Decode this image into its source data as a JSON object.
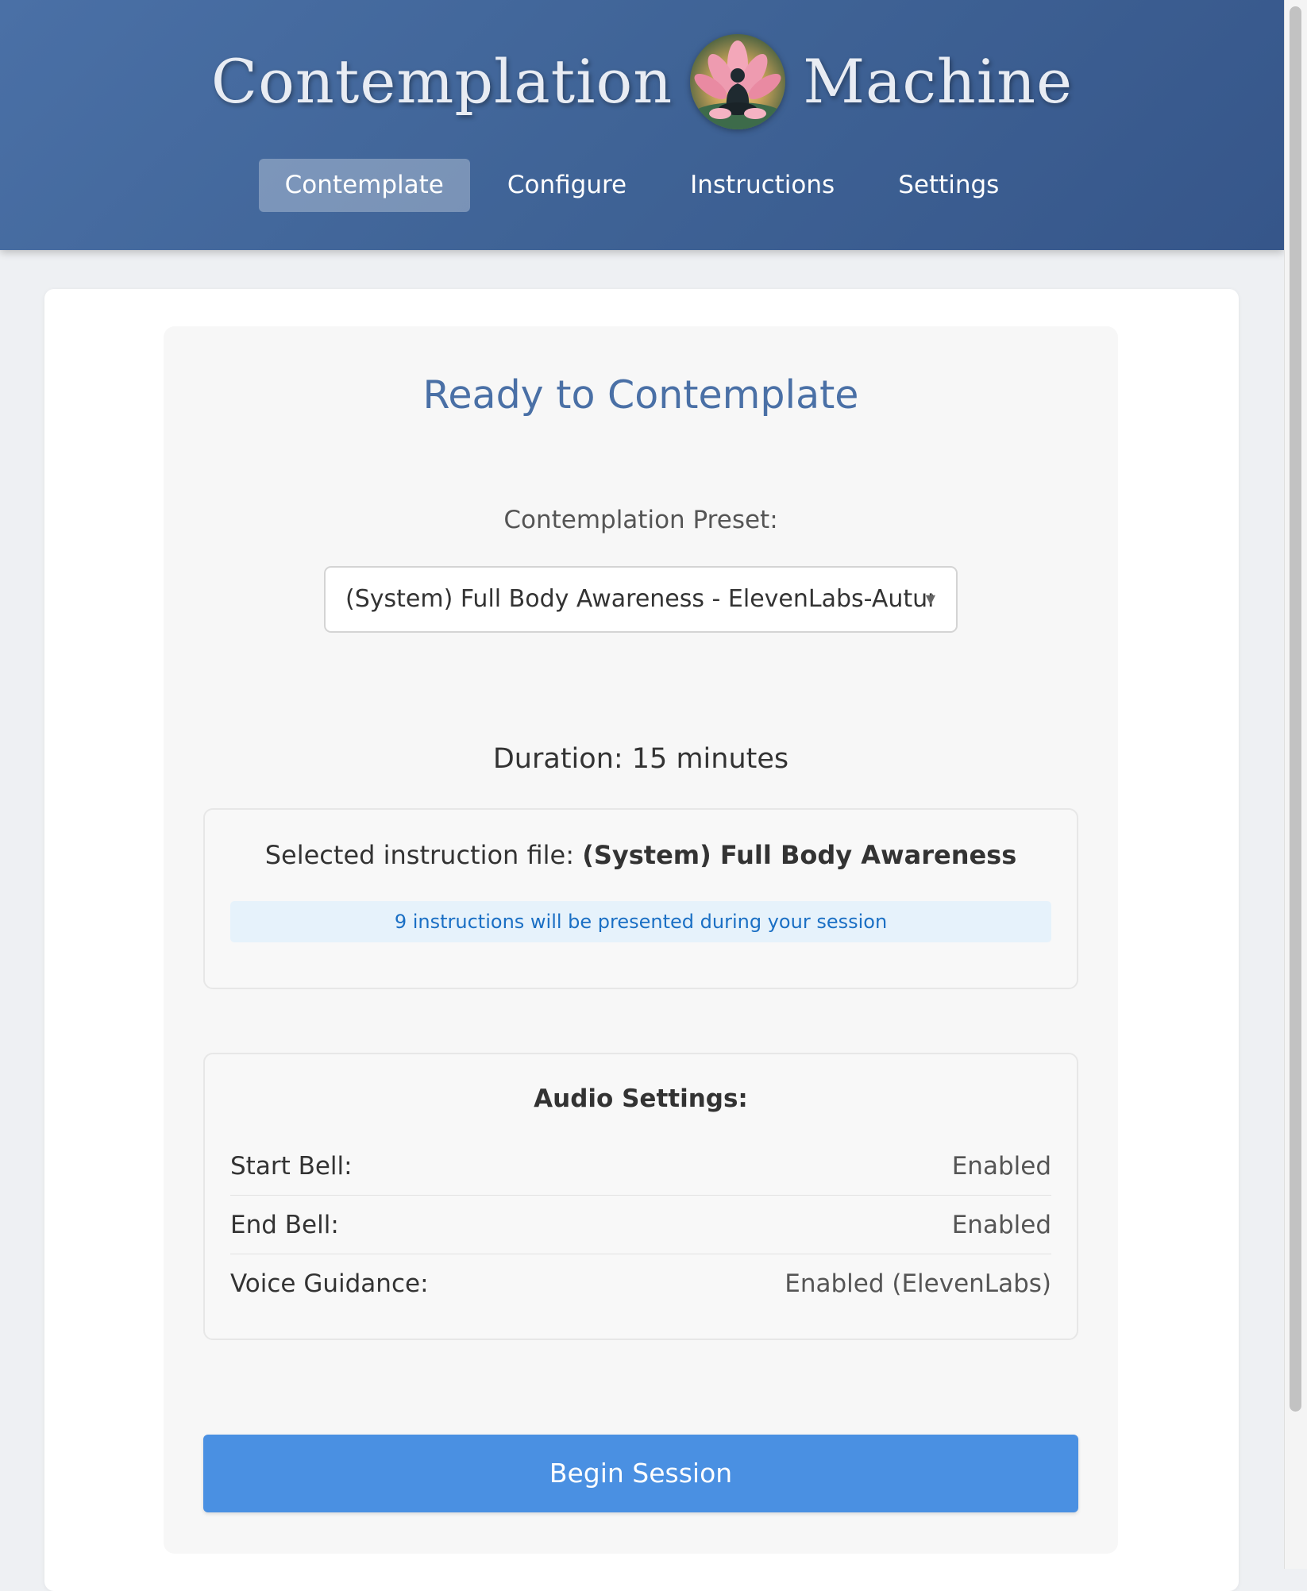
{
  "header": {
    "title_left": "Contemplation",
    "title_right": "Machine",
    "logo_icon": "lotus-meditation-icon"
  },
  "nav": {
    "tabs": [
      {
        "label": "Contemplate",
        "active": true
      },
      {
        "label": "Configure",
        "active": false
      },
      {
        "label": "Instructions",
        "active": false
      },
      {
        "label": "Settings",
        "active": false
      }
    ]
  },
  "main": {
    "title": "Ready to Contemplate",
    "preset_label": "Contemplation Preset:",
    "preset_value": "(System) Full Body Awareness - ElevenLabs-Autumn",
    "duration": "Duration: 15 minutes"
  },
  "instruction_file": {
    "prefix": "Selected instruction file:",
    "name": "(System) Full Body Awareness",
    "info": "9 instructions will be presented during your session"
  },
  "audio": {
    "heading": "Audio Settings:",
    "rows": [
      {
        "label": "Start Bell:",
        "value": "Enabled"
      },
      {
        "label": "End Bell:",
        "value": "Enabled"
      },
      {
        "label": "Voice Guidance:",
        "value": "Enabled (ElevenLabs)"
      }
    ]
  },
  "actions": {
    "begin_label": "Begin Session"
  },
  "colors": {
    "header": "#4a70a6",
    "accent": "#4a90e2",
    "title": "#4a70a6",
    "info_text": "#1a6fc4",
    "info_bg": "#e6f2fb"
  }
}
